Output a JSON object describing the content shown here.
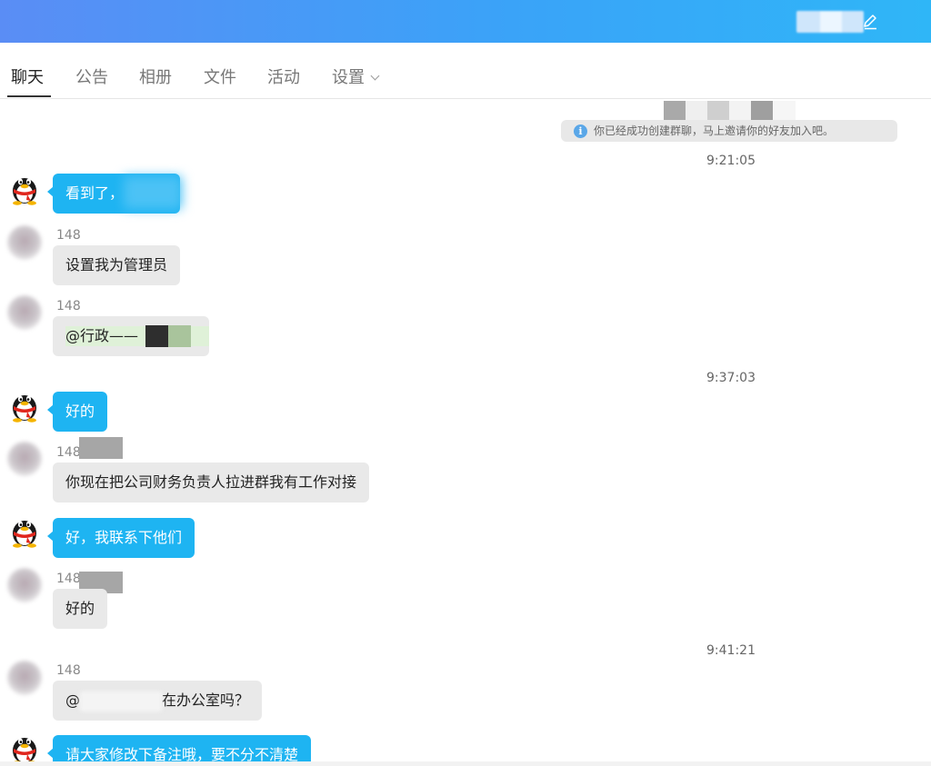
{
  "header": {
    "edit_icon": "pencil-icon",
    "colors": {
      "gradient_start": "#5a8df5",
      "gradient_end": "#2fb6f7"
    }
  },
  "tabs": [
    {
      "label": "聊天",
      "active": true
    },
    {
      "label": "公告",
      "active": false
    },
    {
      "label": "相册",
      "active": false
    },
    {
      "label": "文件",
      "active": false
    },
    {
      "label": "活动",
      "active": false
    },
    {
      "label": "设置",
      "active": false,
      "has_dropdown": true
    }
  ],
  "chat": {
    "system_notice": "你已经成功创建群聊，马上邀请你的好友加入吧。",
    "timestamps": [
      "9:21:05",
      "9:37:03",
      "9:41:21"
    ],
    "messages": [
      {
        "side": "me",
        "avatar": "qq-penguin-icon",
        "text": "看到了，"
      },
      {
        "side": "other",
        "sender": "148",
        "text": "设置我为管理员"
      },
      {
        "side": "other",
        "sender": "148",
        "text": "@行政——"
      },
      {
        "side": "me",
        "avatar": "qq-penguin-icon",
        "text": "好的"
      },
      {
        "side": "other",
        "sender": "148",
        "text": "你现在把公司财务负责人拉进群我有工作对接"
      },
      {
        "side": "me",
        "avatar": "qq-penguin-icon",
        "text": "好，我联系下他们"
      },
      {
        "side": "other",
        "sender": "148",
        "text": "好的"
      },
      {
        "side": "other",
        "sender": "148",
        "text_prefix": "@",
        "text": "在办公室吗？"
      },
      {
        "side": "me",
        "avatar": "qq-penguin-icon",
        "text": "请大家修改下备注哦，要不分不清楚"
      }
    ],
    "colors": {
      "my_bubble": "#1eb4f2",
      "other_bubble": "#e9e9e9"
    }
  }
}
